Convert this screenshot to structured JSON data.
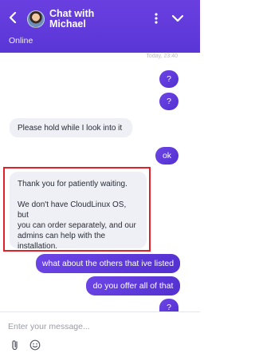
{
  "header": {
    "title": "Chat with Michael",
    "status": "Online"
  },
  "messages": {
    "timestamp": "Today, 23:40",
    "items": [
      {
        "side": "out",
        "text": "?"
      },
      {
        "side": "out",
        "text": "?"
      },
      {
        "side": "in",
        "text": "Please hold while I look into it"
      },
      {
        "side": "out",
        "text": "ok"
      },
      {
        "side": "in",
        "lines": [
          "Thank you for patiently waiting.",
          "",
          "We don't have CloudLinux OS, but",
          "you can order separately, and our",
          "admins can help with the",
          "installation."
        ]
      },
      {
        "side": "out",
        "text": "what about the others that ive listed"
      },
      {
        "side": "out",
        "text": "do you offer all of that"
      },
      {
        "side": "out",
        "text": "?"
      }
    ]
  },
  "composer": {
    "placeholder": "Enter your message..."
  },
  "colors": {
    "accent": "#5a36d6",
    "incoming_bg": "#eef0f5",
    "highlight": "#e2202a"
  },
  "icons": [
    "chevron-left-icon",
    "avatar",
    "kebab-menu-icon",
    "chevron-down-icon",
    "paperclip-icon",
    "smiley-icon"
  ]
}
